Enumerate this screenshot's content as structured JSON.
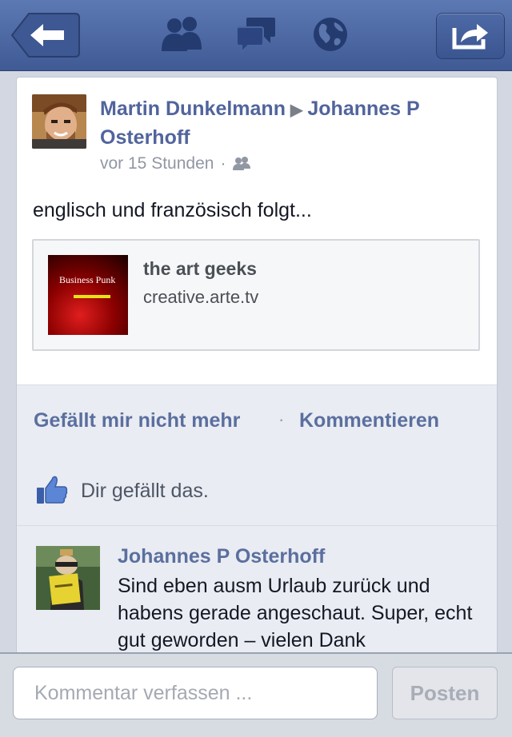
{
  "nav": {
    "back_icon": "back-arrow-icon",
    "friends_icon": "friend-requests-icon",
    "messages_icon": "messages-icon",
    "notifications_icon": "globe-notifications-icon",
    "share_icon": "share-icon"
  },
  "post": {
    "author": "Martin Dunkelmann",
    "target": "Johannes P Osterhoff",
    "separator": "▶",
    "time": "vor 15 Stunden",
    "meta_separator": "·",
    "audience_icon": "friends-audience-icon",
    "text": "englisch und französisch folgt...",
    "link": {
      "title": "the art geeks",
      "url": "creative.arte.tv",
      "thumb_text": "Business Punk"
    }
  },
  "actions": {
    "like_label": "Gefällt mir nicht mehr",
    "separator": "·",
    "comment_label": "Kommentieren"
  },
  "likes": {
    "text": "Dir gefällt das."
  },
  "comment": {
    "author": "Johannes P Osterhoff",
    "text": "Sind eben ausm Urlaub zurück und habens gerade angeschaut. Super, echt gut geworden – vielen Dank"
  },
  "composer": {
    "placeholder": "Kommentar verfassen ...",
    "value": "",
    "post_label": "Posten"
  },
  "colors": {
    "nav_bar": "#4a66a0",
    "link_blue": "#5b6f9f",
    "action_bg": "#e9ecf2"
  }
}
